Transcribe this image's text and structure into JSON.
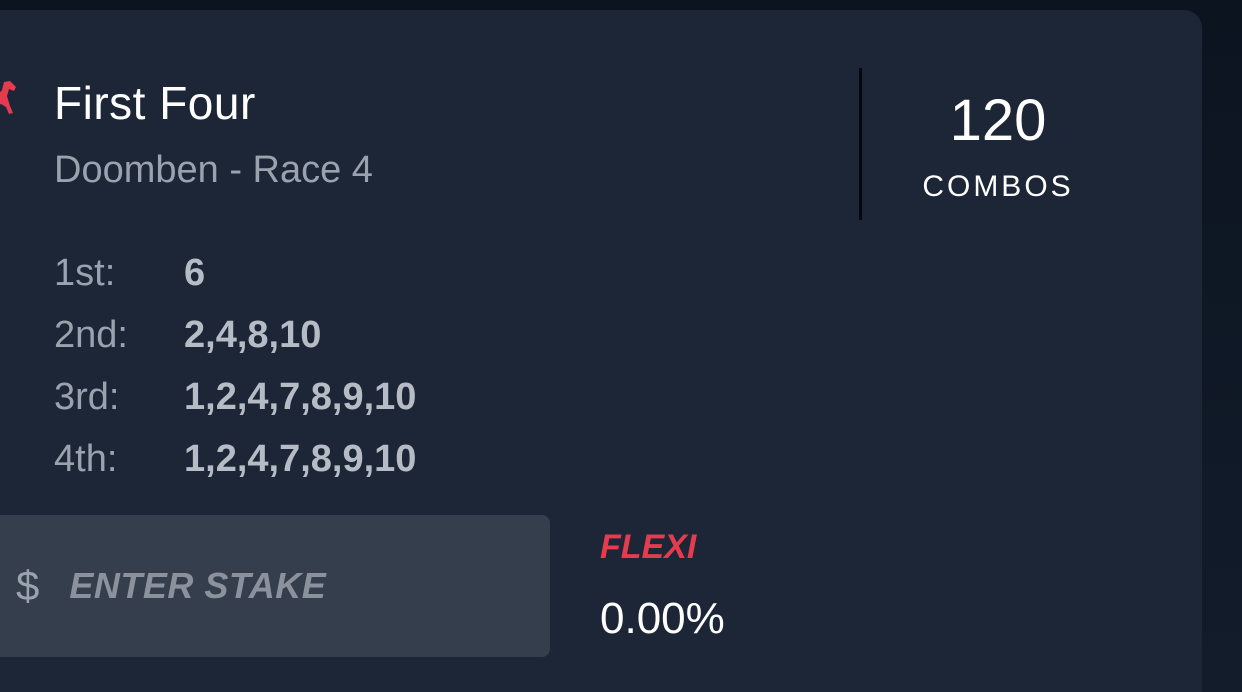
{
  "bet": {
    "title": "First Four",
    "subtitle": "Doomben - Race 4",
    "legs": [
      {
        "label": "1st:",
        "value": "6"
      },
      {
        "label": "2nd:",
        "value": "2,4,8,10"
      },
      {
        "label": "3rd:",
        "value": "1,2,4,7,8,9,10"
      },
      {
        "label": "4th:",
        "value": "1,2,4,7,8,9,10"
      }
    ]
  },
  "combos": {
    "count": "120",
    "label": "COMBOS"
  },
  "stake": {
    "currency": "$",
    "placeholder": "ENTER STAKE"
  },
  "flexi": {
    "label": "FLEXI",
    "value": "0.00%"
  },
  "colors": {
    "accent": "#e43b4e",
    "card": "#1c2636",
    "input": "#353e4c"
  },
  "icons": {
    "race_type": "horse-icon"
  }
}
